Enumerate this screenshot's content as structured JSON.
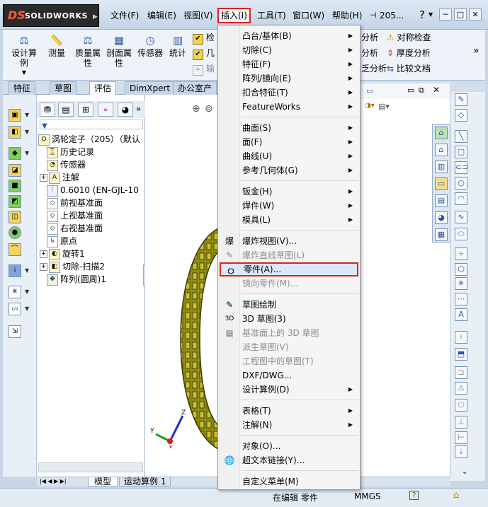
{
  "titlebar": {
    "logo_ds": "DS",
    "logo_text": "SOLIDWORKS",
    "menus": [
      "文件(F)",
      "编辑(E)",
      "视图(V)",
      "插入(I)",
      "工具(T)",
      "窗口(W)",
      "帮助(H)"
    ],
    "doc_short": "205...",
    "help_glyph": "?"
  },
  "commandmanager": {
    "design_study": "设计算例",
    "measure": "测量",
    "mass_properties": "质量属性",
    "section_properties": "剖面属性",
    "sensor": "传感器",
    "statistics": "统计",
    "check": "检",
    "geometry": "几",
    "import_diag": "输",
    "analysis1": "分析",
    "analysis2": "分析",
    "analysis3": "乏分析",
    "symmetry_check": "对称检查",
    "thickness_analysis": "厚度分析",
    "compare_docs": "比较文档"
  },
  "tabs": [
    "特征",
    "草图",
    "评估",
    "DimXpert",
    "办公室产品"
  ],
  "active_tab": "评估",
  "tree": {
    "root": "涡轮定子（205）（默认",
    "items": [
      "历史记录",
      "传感器",
      "注解",
      "0.6010 (EN-GJL-10",
      "前视基准面",
      "上视基准面",
      "右视基准面",
      "原点",
      "旋转1",
      "切除-扫描2",
      "阵列(圆周)1"
    ]
  },
  "menu": {
    "group1": [
      {
        "label": "凸台/基体(B)",
        "sub": true
      },
      {
        "label": "切除(C)",
        "sub": true
      },
      {
        "label": "特征(F)",
        "sub": true
      },
      {
        "label": "阵列/镜向(E)",
        "sub": true
      },
      {
        "label": "扣合特征(T)",
        "sub": true
      },
      {
        "label": "FeatureWorks",
        "sub": true
      }
    ],
    "group2": [
      {
        "label": "曲面(S)",
        "sub": true
      },
      {
        "label": "面(F)",
        "sub": true
      },
      {
        "label": "曲线(U)",
        "sub": true
      },
      {
        "label": "参考几何体(G)",
        "sub": true
      }
    ],
    "group3": [
      {
        "label": "钣金(H)",
        "sub": true
      },
      {
        "label": "焊件(W)",
        "sub": true
      },
      {
        "label": "模具(L)",
        "sub": true
      }
    ],
    "group4": [
      {
        "label": "爆炸视图(V)..."
      },
      {
        "label": "爆炸直线草图(L)"
      },
      {
        "label": "零件(A)..."
      },
      {
        "label": "镜向零件(M)..."
      }
    ],
    "group5": [
      {
        "label": "草图绘制"
      },
      {
        "label": "3D 草图(3)"
      },
      {
        "label": "基准面上的 3D 草图"
      },
      {
        "label": "派生草图(V)"
      },
      {
        "label": "工程图中的草图(T)"
      },
      {
        "label": "DXF/DWG..."
      },
      {
        "label": "设计算例(D)",
        "sub": true
      }
    ],
    "group6": [
      {
        "label": "表格(T)",
        "sub": true
      },
      {
        "label": "注解(N)",
        "sub": true
      }
    ],
    "group7": [
      {
        "label": "对象(O)..."
      },
      {
        "label": "超文本链接(Y)..."
      }
    ],
    "group8": [
      {
        "label": "自定义菜单(M)"
      }
    ]
  },
  "bottom_tabs": [
    "模型",
    "运动算例 1"
  ],
  "status": {
    "editing": "在编辑 零件",
    "units": "MMGS",
    "help_glyph": "?"
  },
  "colors": {
    "highlight_box": "#e02020",
    "model_fill": "#8e8a13"
  }
}
